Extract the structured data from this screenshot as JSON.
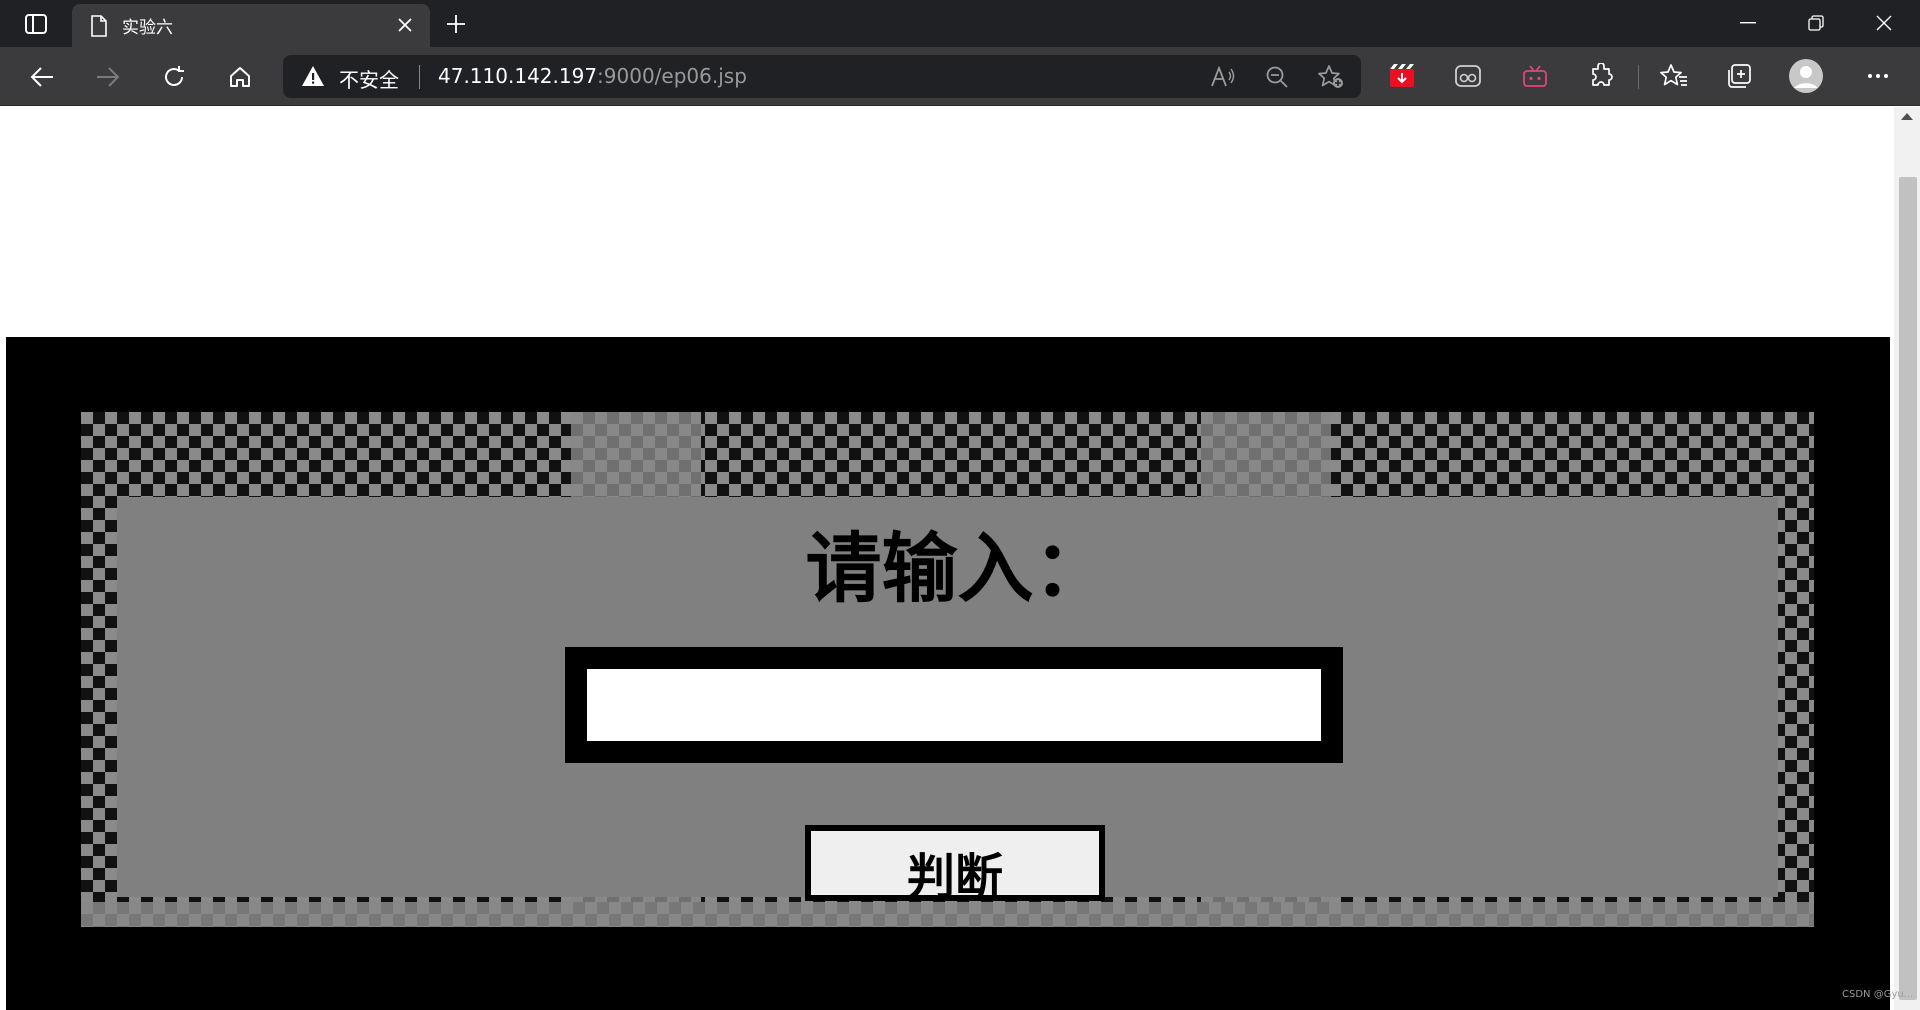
{
  "browser": {
    "tab_title": "实验六",
    "security_label": "不安全",
    "url_host": "47.110.142.197",
    "url_path": ":9000/ep06.jsp"
  },
  "icons": {
    "tab_strip": "tab-strip-icon",
    "document": "document-icon",
    "close_tab": "close-icon",
    "new_tab": "plus-icon",
    "minimize": "minimize-icon",
    "restore": "restore-icon",
    "close_window": "close-icon",
    "back": "back-arrow-icon",
    "forward": "forward-arrow-icon",
    "refresh": "refresh-icon",
    "home": "home-icon",
    "warning": "warning-icon",
    "read_aloud": "read-aloud-icon",
    "zoom_out": "zoom-out-icon",
    "add_favorite": "add-favorite-icon",
    "extensions": "puzzle-icon",
    "favorites": "favorites-icon",
    "collections": "collections-icon",
    "profile": "profile-icon",
    "more": "more-icon"
  },
  "colors": {
    "chrome_dark": "#202124",
    "chrome_toolbar": "#3b3b3d",
    "page_panel": "#000000",
    "frame_gray": "#808080",
    "button_bg": "#efefef"
  },
  "page": {
    "prompt": "请输入：",
    "input_value": "",
    "button_label": "判断"
  },
  "watermark": "CSDN @Gyu..."
}
